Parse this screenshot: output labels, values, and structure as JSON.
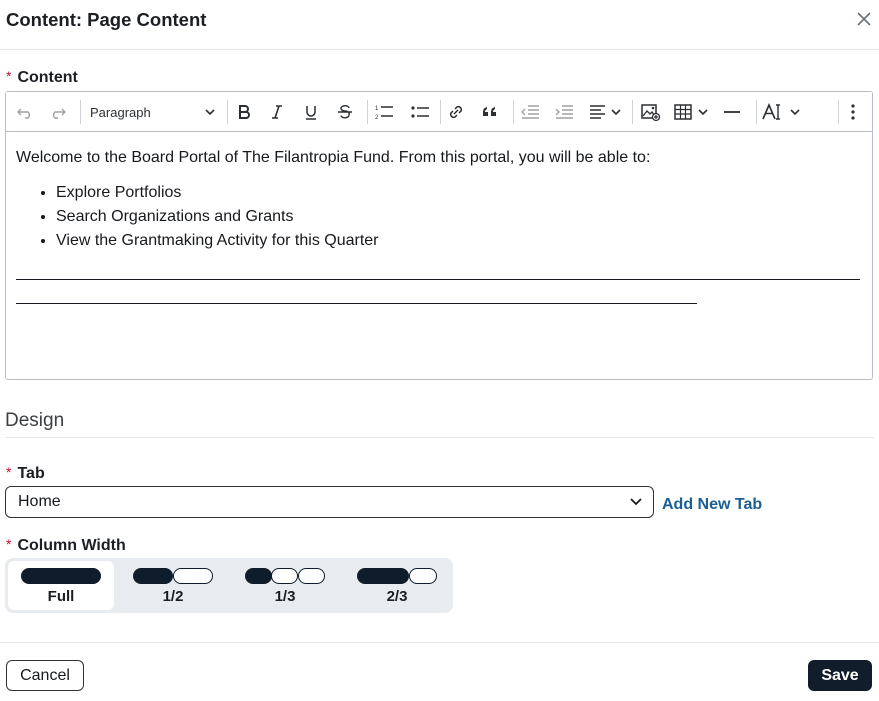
{
  "dialog": {
    "title": "Content: Page Content",
    "close_icon": "close-icon"
  },
  "content_field": {
    "required_mark": "*",
    "label": "Content"
  },
  "toolbar": {
    "paragraph_style": "Paragraph",
    "tools": [
      "undo-icon",
      "redo-icon",
      "bold-icon",
      "italic-icon",
      "underline-icon",
      "strikethrough-icon",
      "numbered-list-icon",
      "bulleted-list-icon",
      "link-icon",
      "blockquote-icon",
      "outdent-icon",
      "indent-icon",
      "align-icon",
      "image-icon",
      "table-icon",
      "horizontal-line-icon",
      "font-size-icon",
      "more-options-icon"
    ],
    "undo_enabled": false,
    "redo_enabled": false
  },
  "editor_body": {
    "intro": "Welcome to the Board Portal of The Filantropia Fund. From this portal, you will be able to:",
    "bullets": [
      "Explore Portfolios",
      "Search Organizations and Grants",
      "View the Grantmaking Activity for this Quarter"
    ]
  },
  "design": {
    "section_title": "Design",
    "tab_field": {
      "required_mark": "*",
      "label": "Tab",
      "selected": "Home",
      "add_link": "Add New Tab"
    },
    "column_width": {
      "required_mark": "*",
      "label": "Column Width",
      "options": [
        "Full",
        "1/2",
        "1/3",
        "2/3"
      ],
      "selected": "Full"
    }
  },
  "footer": {
    "cancel_label": "Cancel",
    "save_label": "Save"
  },
  "colors": {
    "primary_dark": "#111d2b",
    "link": "#1a5e93",
    "required": "#c8102e"
  }
}
